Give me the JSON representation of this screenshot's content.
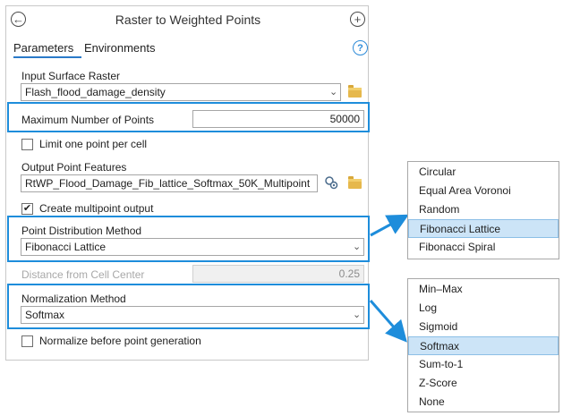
{
  "header": {
    "title": "Raster to Weighted Points",
    "back_icon": "back-arrow-icon",
    "add_icon": "plus-icon"
  },
  "tabs": [
    {
      "label": "Parameters",
      "active": true
    },
    {
      "label": "Environments",
      "active": false
    }
  ],
  "help_icon": "?",
  "params": {
    "input_surface_raster": {
      "label": "Input Surface Raster",
      "value": "Flash_flood_damage_density"
    },
    "max_points": {
      "label": "Maximum Number of Points",
      "value": "50000"
    },
    "limit_one_point": {
      "label": "Limit one point per cell",
      "checked": false
    },
    "output_point_features": {
      "label": "Output Point Features",
      "value": "RtWP_Flood_Damage_Fib_lattice_Softmax_50K_Multipoint"
    },
    "create_multipoint": {
      "label": "Create multipoint output",
      "checked": true
    },
    "point_distribution": {
      "label": "Point Distribution Method",
      "value": "Fibonacci Lattice"
    },
    "distance_from_center": {
      "label": "Distance from Cell Center",
      "value": "0.25"
    },
    "normalization": {
      "label": "Normalization Method",
      "value": "Softmax"
    },
    "normalize_before": {
      "label": "Normalize before point generation",
      "checked": false
    }
  },
  "distribution_options": [
    "Circular",
    "Equal Area Voronoi",
    "Random",
    "Fibonacci Lattice",
    "Fibonacci Spiral"
  ],
  "distribution_selected": "Fibonacci Lattice",
  "normalization_options": [
    "Min–Max",
    "Log",
    "Sigmoid",
    "Softmax",
    "Sum-to-1",
    "Z-Score",
    "None"
  ],
  "normalization_selected": "Softmax",
  "colors": {
    "highlight": "#1e8ddb",
    "selected_bg": "#cce4f7",
    "accent": "#2a7ac8"
  },
  "checkmark": "✔"
}
